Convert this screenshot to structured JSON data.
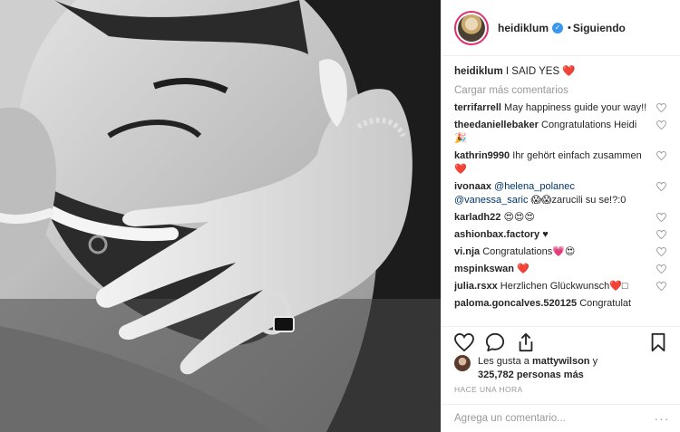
{
  "post": {
    "username": "heidiklum",
    "separator": "•",
    "follow_label": "Siguiendo",
    "verified_glyph": "✓",
    "photo_icon": "engagement-photo",
    "caption": {
      "user": "heidiklum",
      "text": "I SAID YES ❤️"
    },
    "load_more_label": "Cargar más comentarios",
    "comments": [
      {
        "user": "terrifarrell",
        "text": "May happiness guide your way!!"
      },
      {
        "user": "theedaniellebaker",
        "text": "Congratulations Heidi 🎉"
      },
      {
        "user": "kathrin9990",
        "text": "Ihr gehört einfach zusammen ❤️"
      },
      {
        "user": "ivonaax",
        "mention1": "@helena_polanec",
        "mention2": "@vanessa_saric",
        "text": "😱😱zarucili su se!?:0"
      },
      {
        "user": "karladh22",
        "text": "😍😍😍"
      },
      {
        "user": "ashionbax.factory",
        "text": "♥"
      },
      {
        "user": "vi.nja",
        "text": "Congratulations💗😍"
      },
      {
        "user": "mspinkswan",
        "text": "❤️"
      },
      {
        "user": "julia.rsxx",
        "text": "Herzlichen Glückwunsch❤️□"
      },
      {
        "user": "paloma.goncalves.520125",
        "text": "Congratulat"
      }
    ],
    "likes": {
      "prefix": "Les gusta a",
      "user": "mattywilson",
      "joiner": "y",
      "count": "325,782 personas más"
    },
    "timestamp": "HACE UNA HORA",
    "add_comment_placeholder": "Agrega un comentario...",
    "more_glyph": "···",
    "colors": {
      "link": "#003569",
      "muted": "#999999",
      "verified": "#3897f0",
      "heart": "#ed4956"
    }
  }
}
